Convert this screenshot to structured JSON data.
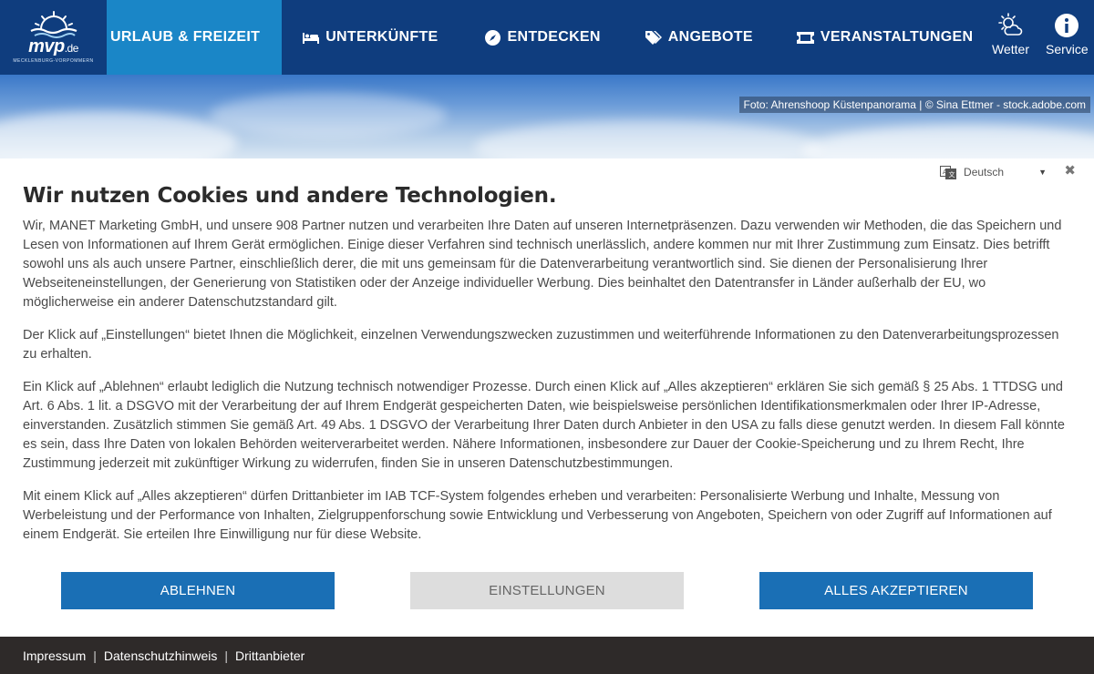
{
  "brand": {
    "logo_text": "mvp",
    "logo_suffix": ".de",
    "logo_sub": "MECKLENBURG-VORPOMMERN"
  },
  "nav": {
    "items": [
      {
        "label": "URLAUB & FREIZEIT",
        "icon": "none",
        "active": true
      },
      {
        "label": "UNTERKÜNFTE",
        "icon": "bed-icon"
      },
      {
        "label": "ENTDECKEN",
        "icon": "compass-icon"
      },
      {
        "label": "ANGEBOTE",
        "icon": "tag-icon"
      },
      {
        "label": "VERANSTALTUNGEN",
        "icon": "ticket-icon"
      }
    ],
    "weather_label": "Wetter",
    "service_label": "Service"
  },
  "hero": {
    "photo_credit": "Foto: Ahrenshoop Küstenpanorama | © Sina Ettmer - stock.adobe.com"
  },
  "cookie": {
    "language": "Deutsch",
    "close_icon": "close-icon",
    "title": "Wir nutzen Cookies und andere Technologien.",
    "paragraphs": [
      "Wir, MANET Marketing GmbH, und unsere 908 Partner nutzen und verarbeiten Ihre Daten auf unseren Internetpräsenzen. Dazu verwenden wir Methoden, die das Speichern und Lesen von Informationen auf Ihrem Gerät ermöglichen. Einige dieser Verfahren sind technisch unerlässlich, andere kommen nur mit Ihrer Zustimmung zum Einsatz. Dies betrifft sowohl uns als auch unsere Partner, einschließlich derer, die mit uns gemeinsam für die Datenverarbeitung verantwortlich sind. Sie dienen der Personalisierung Ihrer Webseiteneinstellungen, der Generierung von Statistiken oder der Anzeige individueller Werbung. Dies beinhaltet den Datentransfer in Länder außerhalb der EU, wo möglicherweise ein anderer Datenschutzstandard gilt.",
      "Der Klick auf „Einstellungen“ bietet Ihnen die Möglichkeit, einzelnen Verwendungszwecken zuzustimmen und weiterführende Informationen zu den Datenverarbeitungsprozessen zu erhalten.",
      "Ein Klick auf „Ablehnen“ erlaubt lediglich die Nutzung technisch notwendiger Prozesse. Durch einen Klick auf „Alles akzeptieren“ erklären Sie sich gemäß § 25 Abs. 1 TTDSG und Art. 6 Abs. 1 lit. a DSGVO mit der Verarbeitung der auf Ihrem Endgerät gespeicherten Daten, wie beispielsweise persönlichen Identifikationsmerkmalen oder Ihrer IP-Adresse, einverstanden. Zusätzlich stimmen Sie gemäß Art. 49 Abs. 1 DSGVO der Verarbeitung Ihrer Daten durch Anbieter in den USA zu falls diese genutzt werden. In diesem Fall könnte es sein, dass Ihre Daten von lokalen Behörden weiterverarbeitet werden. Nähere Informationen, insbesondere zur Dauer der Cookie-Speicherung und zu Ihrem Recht, Ihre Zustimmung jederzeit mit zukünftiger Wirkung zu widerrufen, finden Sie in unseren Datenschutzbestimmungen.",
      "Mit einem Klick auf „Alles akzeptieren“ dürfen Drittanbieter im IAB TCF-System folgendes erheben und verarbeiten: Personalisierte Werbung und Inhalte, Messung von Werbeleistung und der Performance von Inhalten, Zielgruppenforschung sowie Entwicklung und Verbesserung von Angeboten, Speichern von oder Zugriff auf Informationen auf einem Endgerät. Sie erteilen Ihre Einwilligung nur für diese Website."
    ],
    "buttons": {
      "reject": "ABLEHNEN",
      "settings": "EINSTELLUNGEN",
      "accept": "ALLES AKZEPTIEREN"
    }
  },
  "footer": {
    "links": [
      "Impressum",
      "Datenschutzhinweis",
      "Drittanbieter"
    ],
    "separator": "|"
  },
  "colors": {
    "nav_bg": "#0f3d7e",
    "nav_active": "#1a86c7",
    "button_primary": "#1a6fb5",
    "button_secondary": "#dddddd",
    "footer_bg": "#2e2a29"
  }
}
